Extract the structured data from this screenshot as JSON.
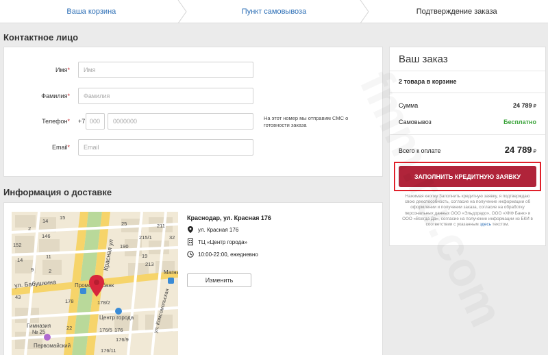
{
  "steps": [
    {
      "label": "Ваша корзина"
    },
    {
      "label": "Пункт самовывоза"
    },
    {
      "label": "Подтверждение заказа"
    }
  ],
  "contact": {
    "title": "Контактное лицо",
    "first_name": {
      "label": "Имя",
      "placeholder": "Имя"
    },
    "last_name": {
      "label": "Фамилия",
      "placeholder": "Фамилия"
    },
    "phone": {
      "label": "Телефон",
      "prefix": "+7",
      "code_placeholder": "000",
      "number_placeholder": "0000000",
      "hint": "На этот номер мы отправим СМС о готовности заказа"
    },
    "email": {
      "label": "Email",
      "placeholder": "Email"
    },
    "required_mark": "*"
  },
  "order": {
    "title": "Ваш заказ",
    "items_count": "2 товара в корзине",
    "sum_label": "Сумма",
    "sum_value": "24 789",
    "pickup_label": "Самовывоз",
    "pickup_value": "Бесплатно",
    "total_label": "Всего к оплате",
    "total_value": "24 789",
    "currency": "₽",
    "credit_button": "ЗАПОЛНИТЬ КРЕДИТНУЮ ЗАЯВКУ",
    "disclaimer_text": "Нажимая кнопку Заполнить кредитную заявку, я подтверждаю свою дееспособность, согласие на получение информации об оформлении и получении заказа, согласие на обработку персональных данных ООО «Эльдорадо», ООО «ХКФ Банк» и ООО «Всегда Да», согласие на получение информации из БКИ в соответствии с указанным",
    "disclaimer_link": "здесь",
    "disclaimer_end": "текстом."
  },
  "delivery": {
    "title": "Информация о доставке",
    "address_title": "Краснодар, ул. Красная 176",
    "street": "ул. Красная 176",
    "mall": "ТЦ «Центр города»",
    "hours": "10:00-22:00, ежедневно",
    "change_button": "Изменить",
    "map_labels": {
      "street1": "Красная ул",
      "street2": "ул. Бабушкина",
      "street3": "ул. Комсомольская",
      "poi1": "Промсвязьбанк",
      "poi2": "Центр города",
      "poi3": "Гимназия\n№ 25",
      "poi4": "Первомайский",
      "poi5": "Магни",
      "n1": "14",
      "n2": "15",
      "n3": "2",
      "n4": "146",
      "n5": "152",
      "n6": "25",
      "n7": "211",
      "n8": "215/1",
      "n9": "32",
      "n10": "190",
      "n11": "19",
      "n12": "213",
      "n13": "14",
      "n14": "11",
      "n15": "9",
      "n16": "2",
      "n17": "178/2",
      "n18": "178",
      "n19": "176/5",
      "n20": "176",
      "n21": "176/9",
      "n22": "176/11",
      "n23": "43",
      "n24": "22"
    }
  },
  "watermark": "fmm.ru.com",
  "colors": {
    "link": "#2a6db5",
    "accent": "#b0243a",
    "green": "#3aa33a",
    "highlight": "#e0202a"
  }
}
